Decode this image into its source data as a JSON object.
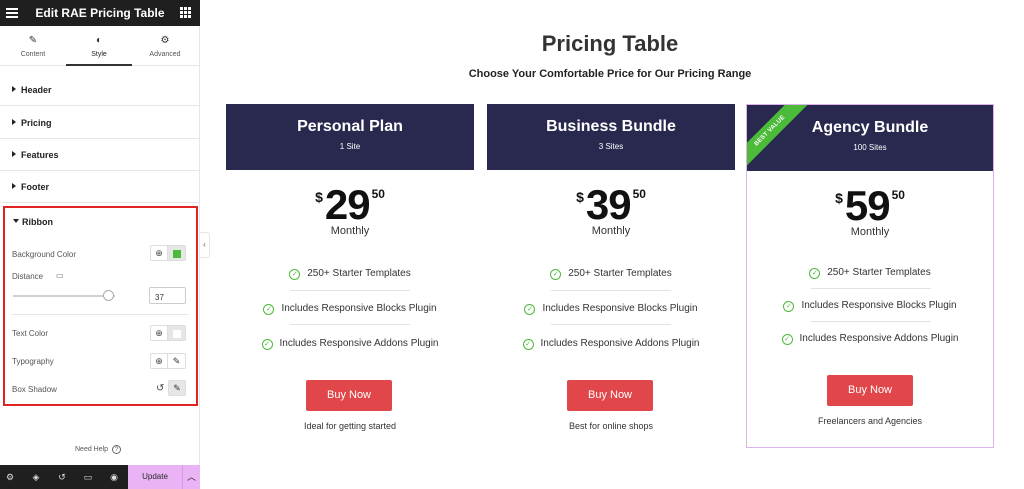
{
  "sidebar": {
    "title": "Edit RAE Pricing Table",
    "tabs": [
      {
        "label": "Content",
        "icon": "pencil-icon"
      },
      {
        "label": "Style",
        "icon": "half-circle-icon"
      },
      {
        "label": "Advanced",
        "icon": "gear-icon"
      }
    ],
    "active_tab": "Style",
    "sections": [
      "Header",
      "Pricing",
      "Features",
      "Footer"
    ],
    "ribbon": {
      "label": "Ribbon",
      "background_color_label": "Background Color",
      "background_color_value": "#4cbb3a",
      "distance_label": "Distance",
      "distance_value": "37",
      "text_color_label": "Text Color",
      "typography_label": "Typography",
      "box_shadow_label": "Box Shadow"
    },
    "need_help": "Need Help",
    "update_label": "Update"
  },
  "main": {
    "title": "Pricing Table",
    "subtitle": "Choose Your Comfortable Price for Our Pricing Range"
  },
  "cards": [
    {
      "plan": "Personal Plan",
      "sites": "1 Site",
      "currency": "$",
      "amount": "29",
      "cents": "50",
      "period": "Monthly",
      "features": [
        "250+ Starter Templates",
        "Includes Responsive Blocks Plugin",
        "Includes Responsive Addons Plugin"
      ],
      "button": "Buy Now",
      "note": "Ideal for getting started"
    },
    {
      "plan": "Business Bundle",
      "sites": "3 Sites",
      "currency": "$",
      "amount": "39",
      "cents": "50",
      "period": "Monthly",
      "features": [
        "250+ Starter Templates",
        "Includes Responsive Blocks Plugin",
        "Includes Responsive Addons Plugin"
      ],
      "button": "Buy Now",
      "note": "Best for online shops"
    },
    {
      "plan": "Agency Bundle",
      "sites": "100 Sites",
      "ribbon": "BEST VALUE",
      "currency": "$",
      "amount": "59",
      "cents": "50",
      "period": "Monthly",
      "features": [
        "250+ Starter Templates",
        "Includes Responsive Blocks Plugin",
        "Includes Responsive Addons Plugin"
      ],
      "button": "Buy Now",
      "note": "Freelancers and Agencies"
    }
  ],
  "colors": {
    "card_header": "#292950",
    "button": "#e1474a",
    "ribbon": "#4cbb3a",
    "highlight_border": "#e02424",
    "update_button": "#e9b3f5"
  }
}
